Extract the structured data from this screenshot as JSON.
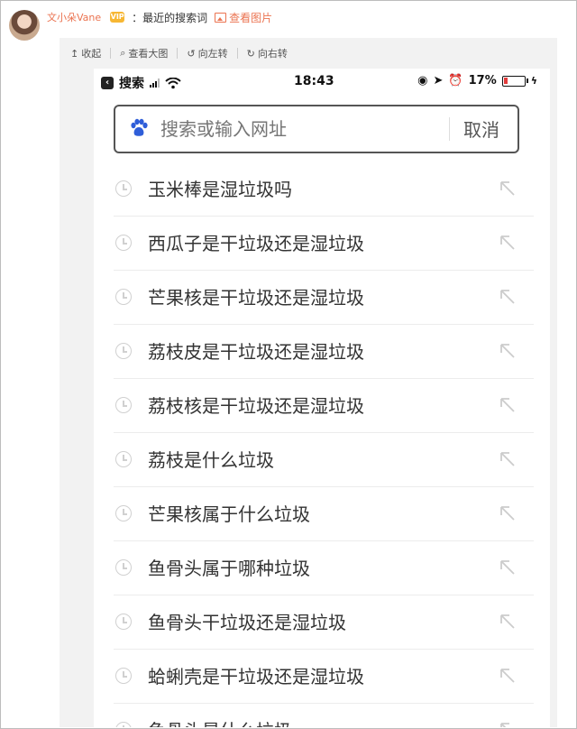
{
  "post": {
    "username": "文小朵Vane",
    "vip_badge": "VIP",
    "text": "：最近的搜索词",
    "view_picture": "查看图片"
  },
  "toolbar": {
    "collapse": "收起",
    "view_large": "查看大图",
    "rotate_left": "向左转",
    "rotate_right": "向右转"
  },
  "statusbar": {
    "back_label": "搜索",
    "time": "18:43",
    "battery_percent": "17%",
    "battery_level": 0.17
  },
  "search": {
    "placeholder": "搜索或输入网址",
    "cancel": "取消"
  },
  "history": [
    "玉米棒是湿垃圾吗",
    "西瓜子是干垃圾还是湿垃圾",
    "芒果核是干垃圾还是湿垃圾",
    "荔枝皮是干垃圾还是湿垃圾",
    "荔枝核是干垃圾还是湿垃圾",
    "荔枝是什么垃圾",
    "芒果核属于什么垃圾",
    "鱼骨头属于哪种垃圾",
    "鱼骨头干垃圾还是湿垃圾",
    "蛤蜊壳是干垃圾还是湿垃圾",
    "鱼骨头是什么垃圾"
  ],
  "colors": {
    "accent": "#eb7350",
    "battery_low": "#e23c3c",
    "baidu_blue": "#2f5ed9"
  }
}
